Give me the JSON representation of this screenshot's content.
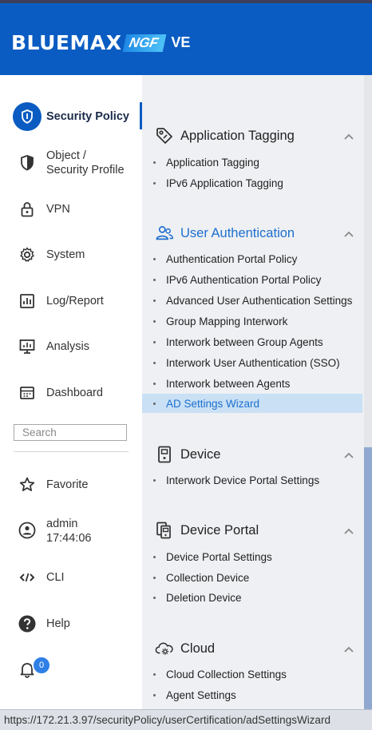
{
  "header": {
    "logo_main": "BLUEMAX",
    "logo_ngf": "NGF",
    "logo_ve": "VE",
    "bg_color": "#0a5cc2"
  },
  "nav": {
    "security_policy": "Security Policy",
    "object_line1": "Object /",
    "object_line2": "Security Profile",
    "vpn": "VPN",
    "system": "System",
    "log_report": "Log/Report",
    "analysis": "Analysis",
    "dashboard": "Dashboard",
    "search_placeholder": "Search",
    "favorite": "Favorite",
    "user_name": "admin",
    "user_time": "17:44:06",
    "cli": "CLI",
    "help": "Help",
    "notification_count": "0"
  },
  "sections": {
    "app_tagging": {
      "title": "Application Tagging",
      "icon": "tag-icon",
      "items": [
        "Application Tagging",
        "IPv6 Application Tagging"
      ]
    },
    "user_auth": {
      "title": "User Authentication",
      "icon": "users-icon",
      "items": [
        "Authentication Portal Policy",
        "IPv6 Authentication Portal Policy",
        "Advanced User Authentication Settings",
        "Group Mapping Interwork",
        "Interwork between Group Agents",
        "Interwork User Authentication (SSO)",
        "Interwork between Agents",
        "AD Settings Wizard"
      ],
      "selected": "AD Settings Wizard"
    },
    "device": {
      "title": "Device",
      "icon": "device-icon",
      "items": [
        "Interwork Device Portal Settings"
      ]
    },
    "device_portal": {
      "title": "Device Portal",
      "icon": "device-portal-icon",
      "items": [
        "Device Portal Settings",
        "Collection Device",
        "Deletion Device"
      ]
    },
    "cloud": {
      "title": "Cloud",
      "icon": "cloud-gear-icon",
      "items": [
        "Cloud Collection Settings",
        "Agent Settings"
      ]
    }
  },
  "status_bar": {
    "url": "https://172.21.3.97/securityPolicy/userCertification/adSettingsWizard"
  }
}
